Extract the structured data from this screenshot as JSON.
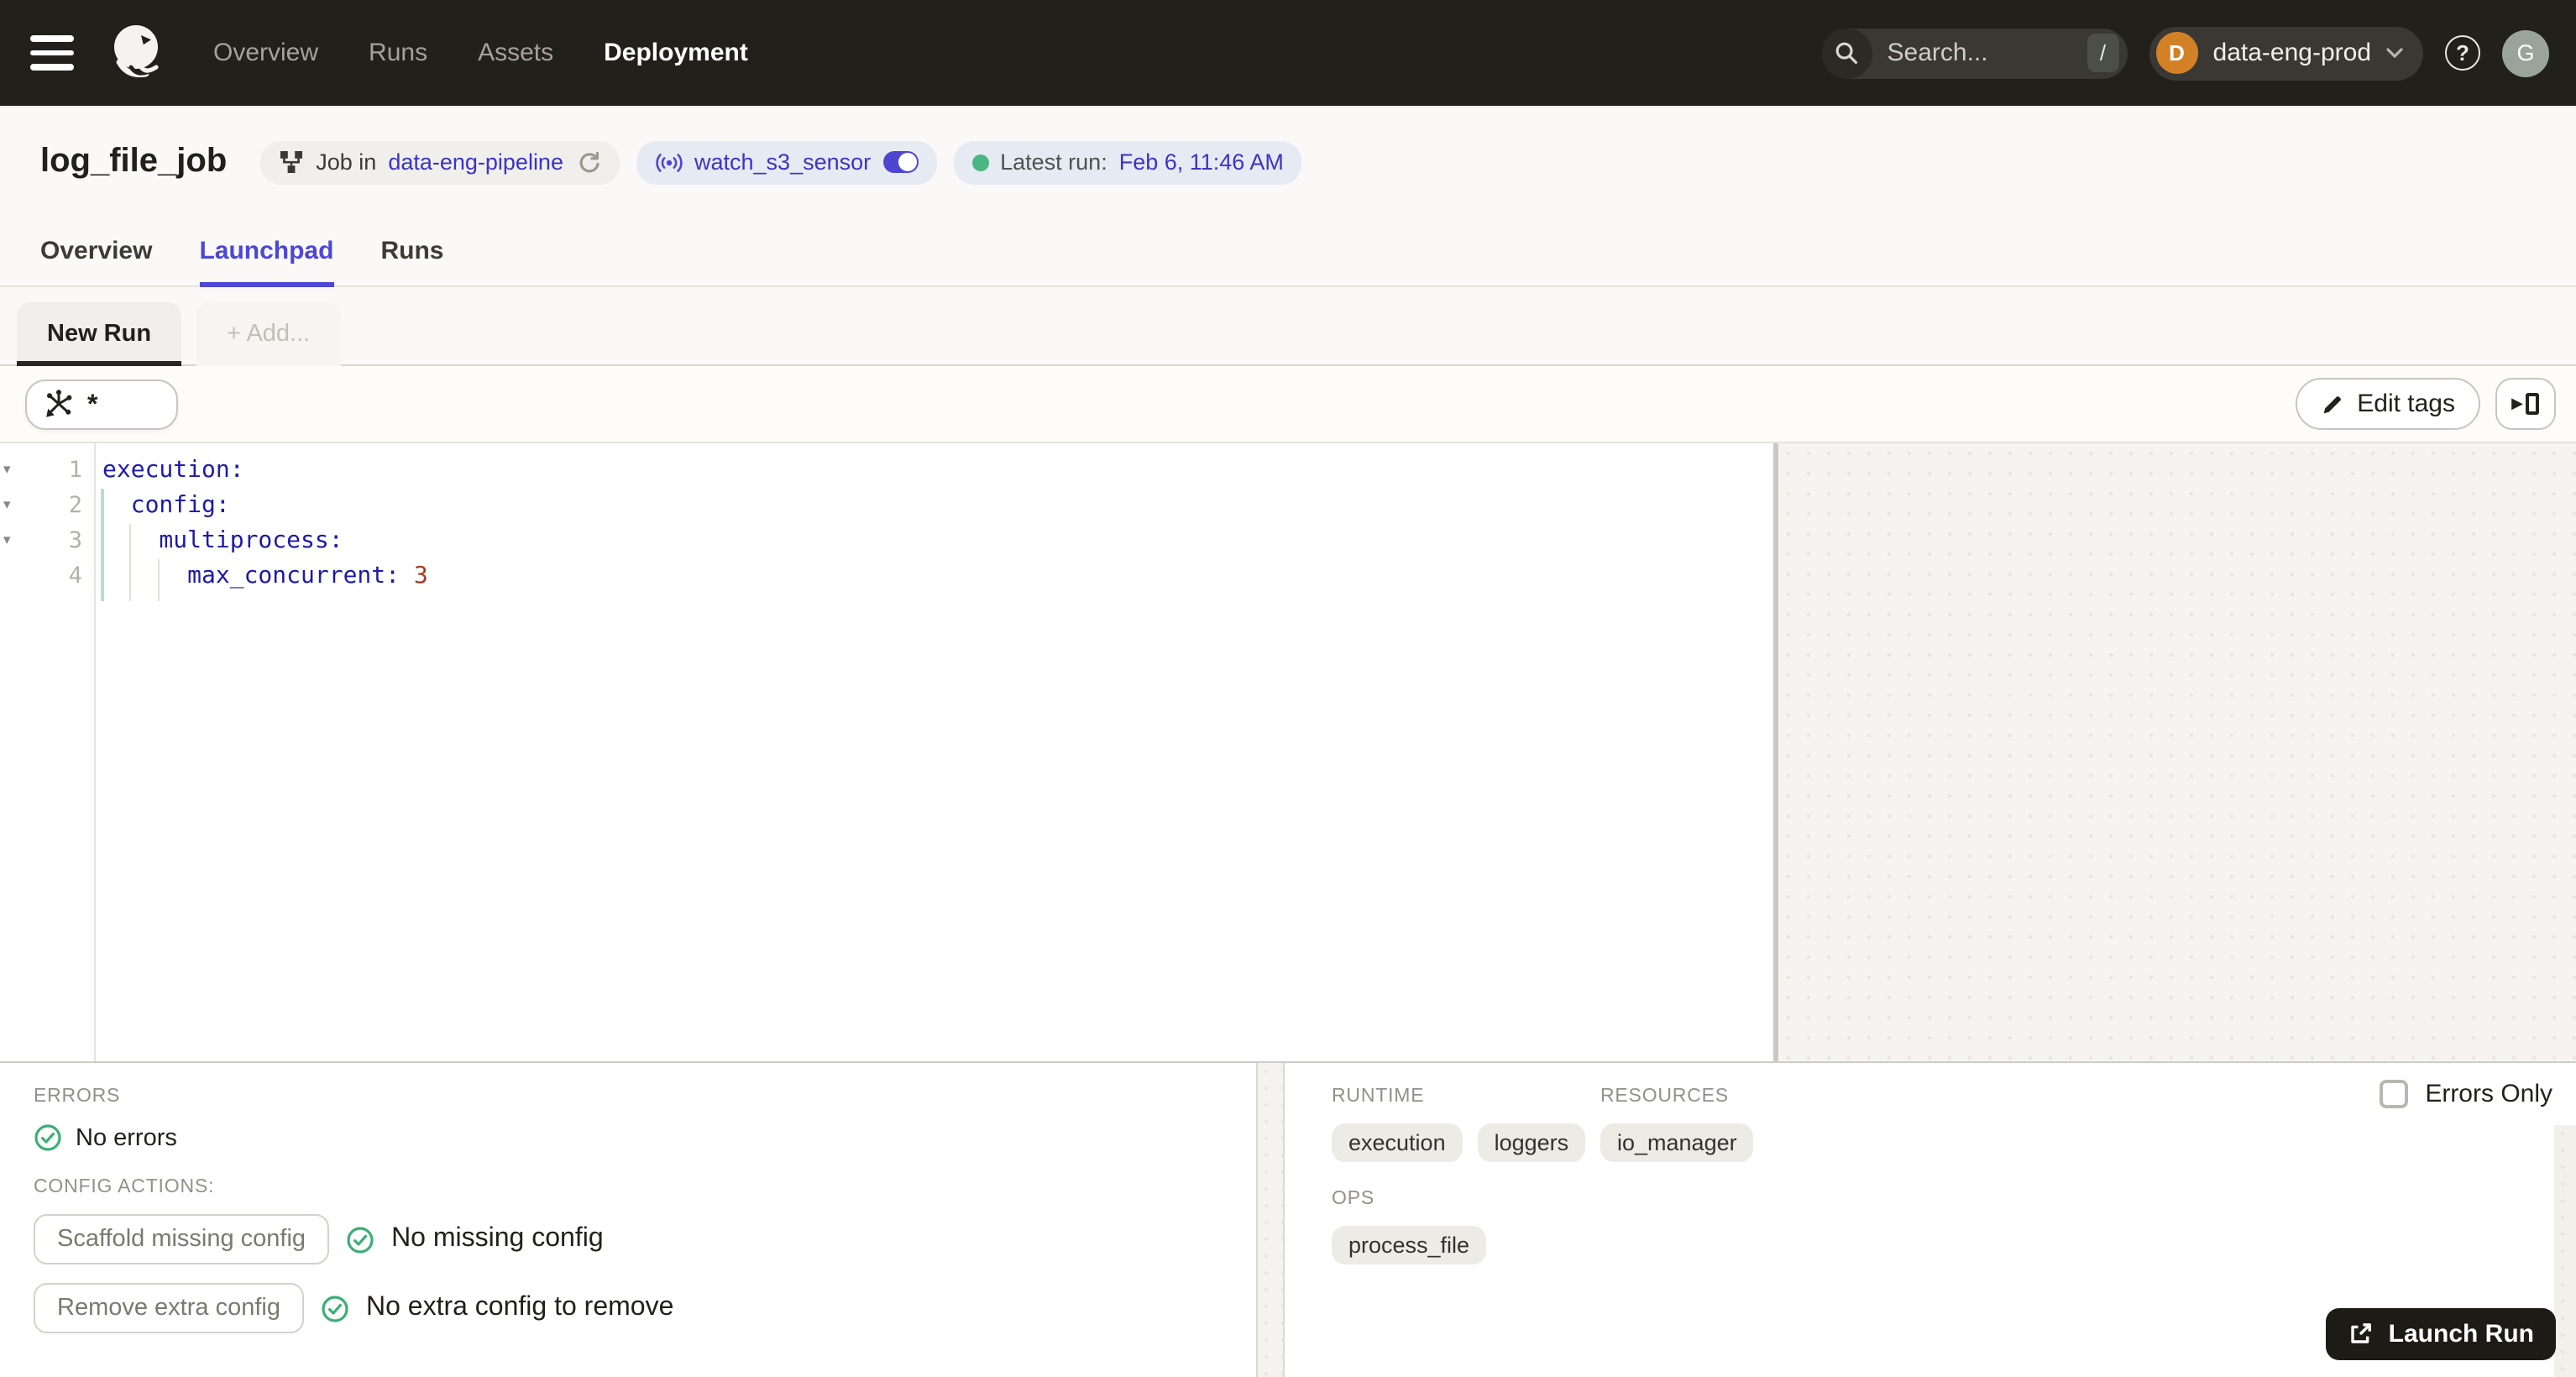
{
  "colors": {
    "nav-bg": "#22201b",
    "page-bg": "#faf9f7",
    "text-dark": "#21201d",
    "label-muted": "#93908a",
    "link-blue": "#3b34c4",
    "tab-active": "#4d47d6",
    "badge-gray-bg": "#f0efeb",
    "badge-blue-bg": "#e6eaf3",
    "status-green": "#3cae77",
    "run-dot-green": "#4cb684",
    "yaml-key": "#1e1aa8",
    "yaml-number": "#a33d20",
    "tag-bg": "#edebe6",
    "launch-bg": "#1d1b16",
    "workspace-avatar-bg": "#d28127",
    "sensor-toggle": "#4f46d0"
  },
  "icons": {
    "fold": "▾",
    "help": "?"
  },
  "nav": {
    "items": [
      {
        "label": "Overview"
      },
      {
        "label": "Runs"
      },
      {
        "label": "Assets"
      },
      {
        "label": "Deployment",
        "active": true
      }
    ],
    "search": {
      "placeholder": "Search...",
      "shortcut": "/"
    },
    "workspace": {
      "initial": "D",
      "name": "data-eng-prod"
    },
    "user_initial": "G"
  },
  "header": {
    "title": "log_file_job",
    "job_badge": {
      "prefix": "Job in",
      "link": "data-eng-pipeline"
    },
    "sensor_badge": {
      "label": "watch_s3_sensor"
    },
    "latest_run_badge": {
      "label": "Latest run:",
      "value": "Feb 6, 11:46 AM"
    }
  },
  "tabs": [
    {
      "label": "Overview"
    },
    {
      "label": "Launchpad",
      "active": true
    },
    {
      "label": "Runs"
    }
  ],
  "launchpad": {
    "config_tabs": {
      "new_run": "New Run",
      "add": "+ Add..."
    },
    "op_selector": "*",
    "edit_tags": "Edit tags"
  },
  "editor": {
    "lines": [
      {
        "num": "1",
        "key": "execution:",
        "value": ""
      },
      {
        "num": "2",
        "key": "  config:",
        "value": ""
      },
      {
        "num": "3",
        "key": "    multiprocess:",
        "value": ""
      },
      {
        "num": "4",
        "key": "      max_concurrent:",
        "value": " 3"
      }
    ]
  },
  "bottom": {
    "errors_label": "ERRORS",
    "no_errors": "No errors",
    "config_actions_label": "CONFIG ACTIONS:",
    "actions": [
      {
        "button": "Scaffold missing config",
        "status": "No missing config"
      },
      {
        "button": "Remove extra config",
        "status": "No extra config to remove"
      }
    ],
    "schema": {
      "runtime_label": "RUNTIME",
      "runtime_tags": [
        "execution",
        "loggers"
      ],
      "resources_label": "RESOURCES",
      "resources_tags": [
        "io_manager"
      ],
      "ops_label": "OPS",
      "ops_tags": [
        "process_file"
      ]
    },
    "errors_only": "Errors Only",
    "launch_run": "Launch Run"
  }
}
